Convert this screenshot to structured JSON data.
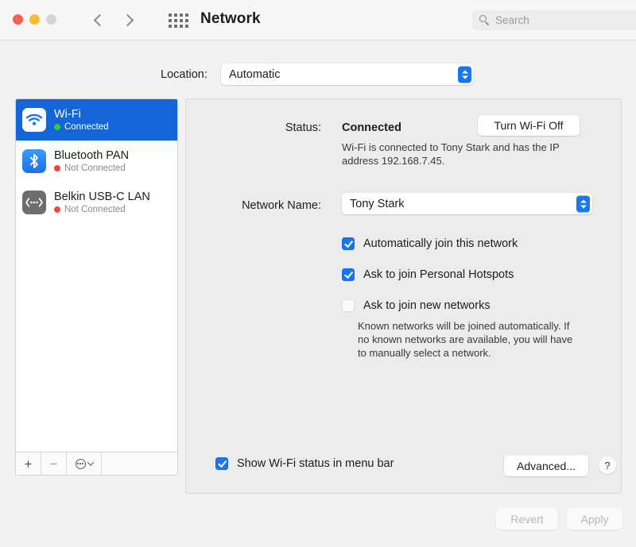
{
  "window": {
    "title": "Network",
    "traffic_lights": [
      "close",
      "minimize",
      "zoom"
    ],
    "colors": {
      "accent": "#1876f2",
      "selection": "#1466d8",
      "connected": "#2ecb44",
      "not_connected": "#f5453b",
      "titlebar_bg": "#f7f7f7",
      "panel_bg": "#ececec",
      "sidebar_bg": "#ffffff"
    }
  },
  "toolbar": {
    "back_icon": "chevron-left-icon",
    "forward_icon": "chevron-right-icon",
    "grid_icon": "app-grid-icon",
    "search": {
      "icon": "search-icon",
      "placeholder": "Search",
      "value": ""
    }
  },
  "location": {
    "label": "Location:",
    "value": "Automatic",
    "options": [
      "Automatic"
    ]
  },
  "sidebar": {
    "services": [
      {
        "name": "Wi-Fi",
        "status": "Connected",
        "status_color": "#2ecb44",
        "icon": "wifi-icon",
        "selected": true
      },
      {
        "name": "Bluetooth PAN",
        "status": "Not Connected",
        "status_color": "#f5453b",
        "icon": "bluetooth-icon",
        "selected": false
      },
      {
        "name": "Belkin USB-C LAN",
        "status": "Not Connected",
        "status_color": "#f5453b",
        "icon": "ethernet-icon",
        "selected": false
      }
    ],
    "toolbar": {
      "add_label": "+",
      "remove_label": "−",
      "action_icon": "action-menu-icon"
    }
  },
  "detail": {
    "status_label": "Status:",
    "status_value": "Connected",
    "toggle_button": "Turn Wi-Fi Off",
    "status_description": "Wi-Fi is connected to Tony Stark and has the IP address 192.168.7.45.",
    "network_name_label": "Network Name:",
    "network_name_value": "Tony Stark",
    "network_name_options": [
      "Tony Stark"
    ],
    "checkboxes": [
      {
        "label": "Automatically join this network",
        "checked": true
      },
      {
        "label": "Ask to join Personal Hotspots",
        "checked": true
      },
      {
        "label": "Ask to join new networks",
        "checked": false
      }
    ],
    "note": "Known networks will be joined automatically. If no known networks are available, you will have to manually select a network.",
    "menu_bar_checkbox": {
      "label": "Show Wi-Fi status in menu bar",
      "checked": true
    },
    "advanced_button": "Advanced...",
    "help_button": "?"
  },
  "footer": {
    "revert_button": "Revert",
    "apply_button": "Apply",
    "revert_enabled": false,
    "apply_enabled": false
  }
}
